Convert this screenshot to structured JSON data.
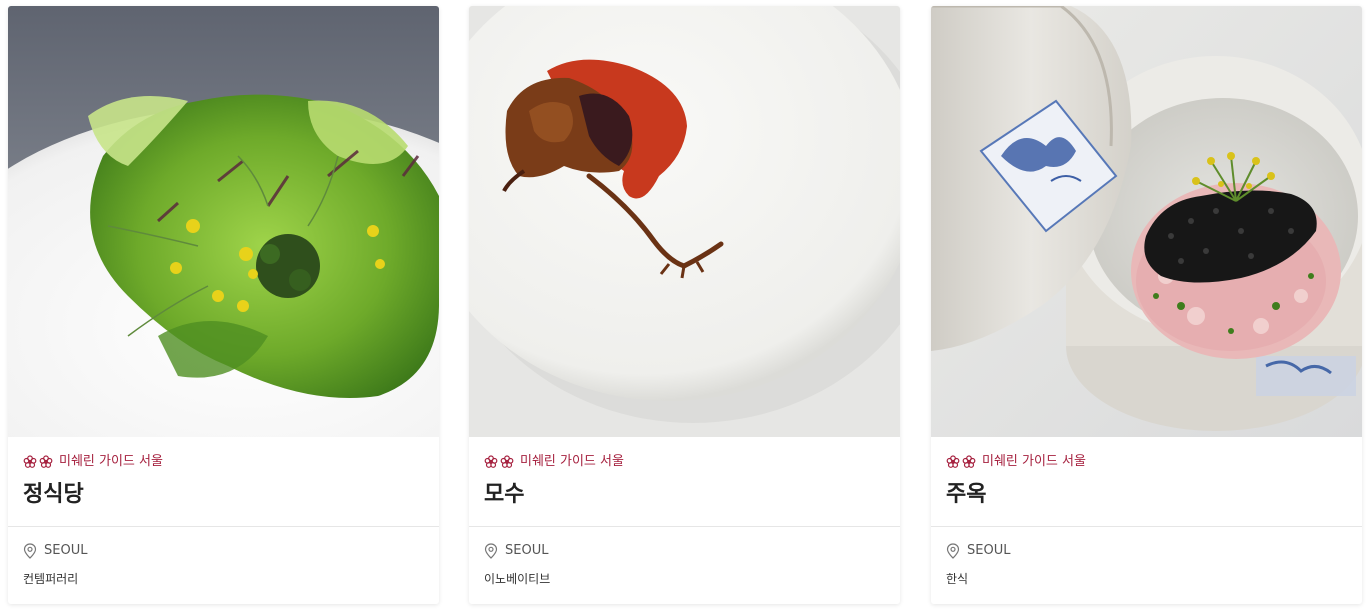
{
  "cards": [
    {
      "image_alt": "herb salad dish",
      "distinction": "미쉐린 가이드 서울",
      "star_icon": "michelin-star-icon",
      "name": "정식당",
      "location": "SEOUL",
      "cuisine": "컨템퍼러리"
    },
    {
      "image_alt": "roasted pigeon dish",
      "distinction": "미쉐린 가이드 서울",
      "star_icon": "michelin-star-icon",
      "name": "모수",
      "location": "SEOUL",
      "cuisine": "이노베이티브"
    },
    {
      "image_alt": "caviar in ceramic bowl",
      "distinction": "미쉐린 가이드 서울",
      "star_icon": "michelin-star-icon",
      "name": "주옥",
      "location": "SEOUL",
      "cuisine": "한식"
    }
  ],
  "colors": {
    "michelin_red": "#a6213f",
    "title": "#222222",
    "meta": "#555555"
  }
}
